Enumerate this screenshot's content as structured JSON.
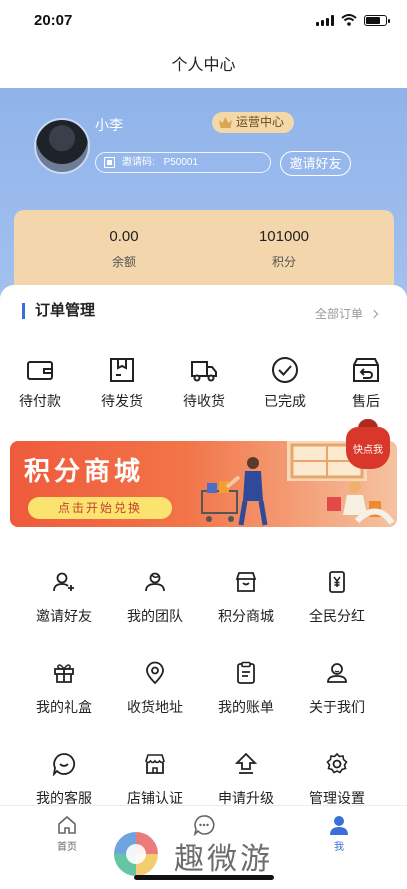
{
  "status_bar": {
    "time": "20:07"
  },
  "header": {
    "title": "个人中心"
  },
  "profile": {
    "username": "小李",
    "badge": "运营中心",
    "invite_code_label": "邀请码:",
    "invite_code": "P50001",
    "invite_button": "邀请好友"
  },
  "balance": {
    "items": [
      {
        "value": "0.00",
        "label": "余额"
      },
      {
        "value": "101000",
        "label": "积分"
      }
    ]
  },
  "orders": {
    "title": "订单管理",
    "all_label": "全部订单",
    "items": [
      {
        "label": "待付款",
        "icon": "wallet-icon"
      },
      {
        "label": "待发货",
        "icon": "package-icon"
      },
      {
        "label": "待收货",
        "icon": "truck-icon"
      },
      {
        "label": "已完成",
        "icon": "check-circle-icon"
      },
      {
        "label": "售后",
        "icon": "return-box-icon"
      }
    ]
  },
  "banner": {
    "title": "积分商城",
    "button": "点击开始兑换",
    "quick_button": "快点我"
  },
  "services": {
    "items": [
      {
        "label": "邀请好友",
        "icon": "add-user-icon"
      },
      {
        "label": "我的团队",
        "icon": "team-icon"
      },
      {
        "label": "积分商城",
        "icon": "store-icon"
      },
      {
        "label": "全民分红",
        "icon": "dividend-icon"
      },
      {
        "label": "我的礼盒",
        "icon": "gift-icon"
      },
      {
        "label": "收货地址",
        "icon": "location-icon"
      },
      {
        "label": "我的账单",
        "icon": "bill-icon"
      },
      {
        "label": "关于我们",
        "icon": "about-icon"
      },
      {
        "label": "我的客服",
        "icon": "chat-icon"
      },
      {
        "label": "店铺认证",
        "icon": "shop-verify-icon"
      },
      {
        "label": "申请升级",
        "icon": "upgrade-icon"
      },
      {
        "label": "管理设置",
        "icon": "settings-icon"
      }
    ]
  },
  "tabbar": {
    "items": [
      {
        "label": "首页",
        "icon": "home-icon"
      },
      {
        "label": "",
        "icon": "message-icon"
      },
      {
        "label": "我",
        "icon": "user-icon"
      }
    ],
    "active_index": 2
  },
  "watermark": {
    "text": "趣微游"
  },
  "colors": {
    "accent": "#3a6fd8",
    "profile_bg": "#8fb3ea",
    "card": "#f3d6ab",
    "banner": "#ef5a3c"
  }
}
